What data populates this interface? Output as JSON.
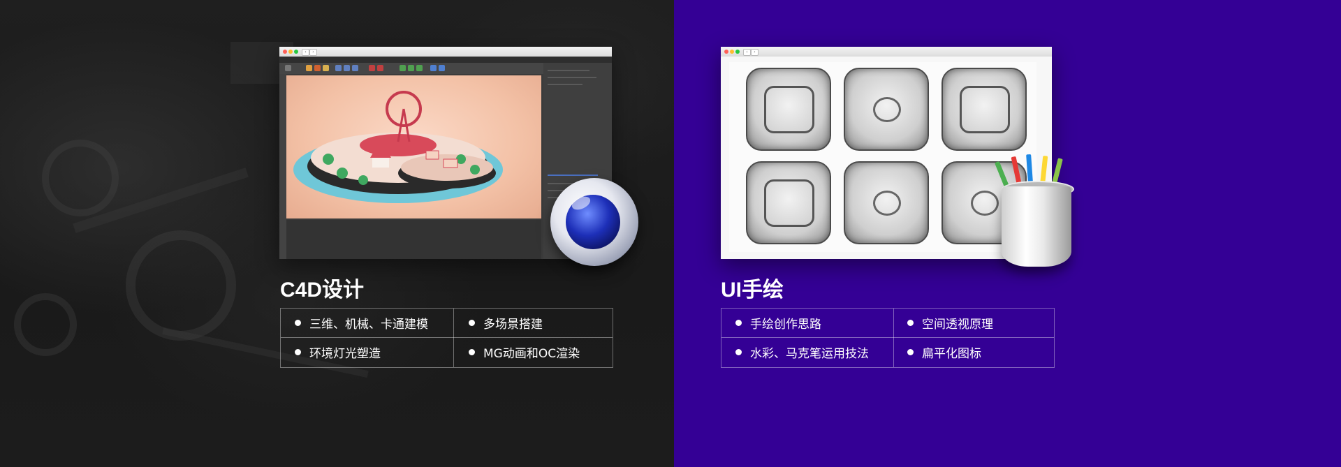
{
  "left_section": {
    "title": "C4D设计",
    "features": [
      "三维、机械、卡通建模",
      "多场景搭建",
      "环境灯光塑造",
      "MG动画和OC渲染"
    ],
    "background_color": "#1d1d1d",
    "logo_icon": "cinema4d-logo-icon"
  },
  "right_section": {
    "title": "UI手绘",
    "features": [
      "手绘创作思路",
      "空间透视原理",
      "水彩、马克笔运用技法",
      "扁平化图标"
    ],
    "background_color": "#340095",
    "decoration_icon": "pencil-cup-icon"
  },
  "colors": {
    "text": "#ffffff",
    "divider": "rgba(255,255,255,0.38)"
  }
}
